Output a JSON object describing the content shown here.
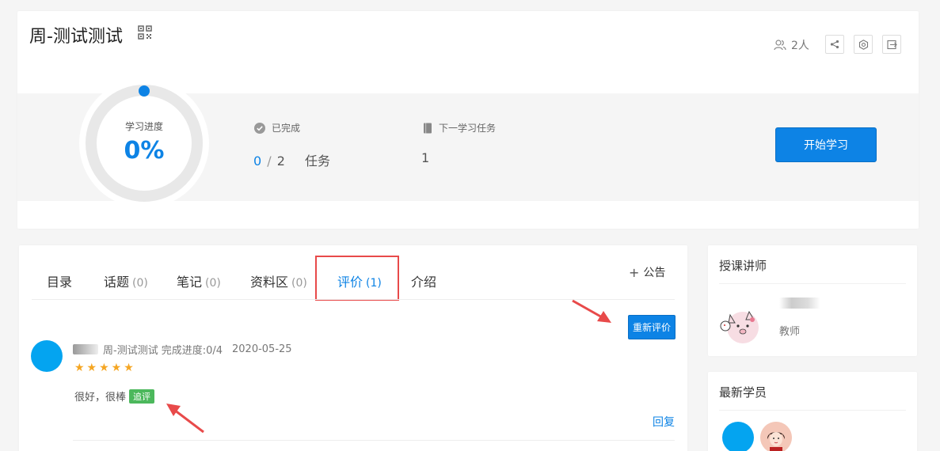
{
  "course": {
    "title": "周-测试测试",
    "member_count": "2人"
  },
  "progress": {
    "label": "学习进度",
    "value": "0%",
    "completed_label": "已完成",
    "completed_done": "0",
    "completed_sep": "/",
    "completed_total": "2",
    "completed_unit": "任务",
    "next_task_label": "下一学习任务",
    "next_task_value": "1",
    "start_button": "开始学习"
  },
  "tabs": [
    {
      "label": "目录",
      "count": ""
    },
    {
      "label": "话题",
      "count": "(0)"
    },
    {
      "label": "笔记",
      "count": "(0)"
    },
    {
      "label": "资料区",
      "count": "(0)"
    },
    {
      "label": "评价",
      "count": "(1)"
    },
    {
      "label": "介绍",
      "count": ""
    }
  ],
  "announce_label": "公告",
  "rereview_button": "重新评价",
  "review": {
    "course": "周-测试测试",
    "progress": "完成进度:0/4",
    "date": "2020-05-25",
    "stars": "★★★★★",
    "text": "很好，很棒",
    "followup_badge": "追评",
    "reply_link": "回复"
  },
  "teacher_panel": {
    "title": "授课讲师",
    "role": "教师"
  },
  "students_panel": {
    "title": "最新学员"
  },
  "colors": {
    "accent": "#0d83e5",
    "star": "#f5a623",
    "badge": "#4cb85c",
    "annotation": "#e84a4a"
  }
}
